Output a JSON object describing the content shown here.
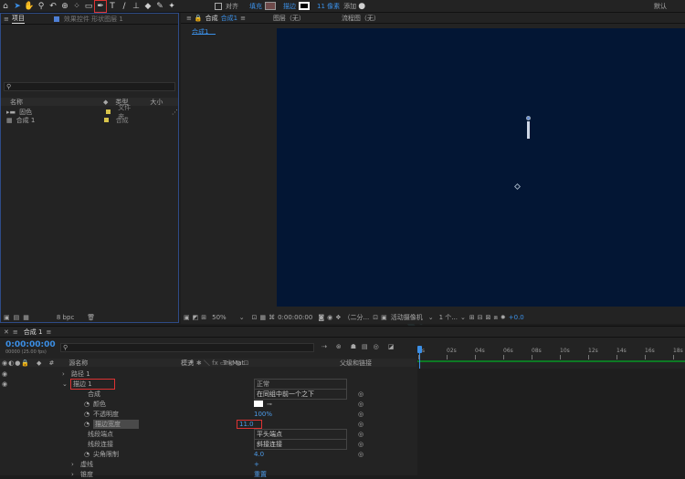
{
  "toolbar": {
    "align_label": "对齐",
    "fill_label": "填充",
    "stroke_label": "描边",
    "stroke_width": "11 像素",
    "add_label": "添加",
    "workspace": "默认",
    "fill_color": "#ffffff",
    "stroke_color": "#6f4b4b"
  },
  "project": {
    "tab": "项目",
    "layer_title": "效果控件 形状图层 1",
    "search_placeholder": "",
    "columns": {
      "name": "名称",
      "type": "类型",
      "size": "大小"
    },
    "items": [
      {
        "name": "固色",
        "type": "文件夹",
        "color": "#d7c34b"
      },
      {
        "name": "合成 1",
        "type": "合成",
        "color": "#d7c34b"
      }
    ],
    "bpc": "8 bpc"
  },
  "viewer": {
    "tabs": {
      "comp": "合成",
      "comp_name": "合成1",
      "layer": "图层（无）",
      "flow": "流程图（无）"
    },
    "subtab": "合成1",
    "bottom": {
      "zoom": "50%",
      "timecode": "0:00:00:00",
      "resolution": "（二分...",
      "camera": "活动摄像机",
      "views": "1 个...",
      "exposure": "+0.0"
    }
  },
  "timeline": {
    "tab": "合成 1",
    "timecode": "0:00:00:00",
    "fps": "00000 (25.00 fps)",
    "cols": {
      "source": "源名称",
      "mode": "模式",
      "trk": "TrkMat",
      "parent": "父级和链接"
    },
    "ruler": [
      "0s",
      "02s",
      "04s",
      "06s",
      "08s",
      "10s",
      "12s",
      "14s",
      "16s",
      "18s"
    ],
    "rows": [
      {
        "label": "路径 1",
        "indent": 78,
        "arrow": ">"
      },
      {
        "label": "描边 1",
        "indent": 78,
        "arrow": "v",
        "mode": "正常",
        "boxed": true
      },
      {
        "label": "合成",
        "indent": 96,
        "value": "在同组中前一个之下"
      },
      {
        "label": "颜色",
        "indent": 102,
        "stopwatch": true
      },
      {
        "label": "不透明度",
        "indent": 102,
        "stopwatch": true,
        "value": "100%"
      },
      {
        "label": "描边宽度",
        "indent": 102,
        "stopwatch": true,
        "value": "11.0",
        "highlight": true
      },
      {
        "label": "线段端点",
        "indent": 96,
        "value": "平头端点"
      },
      {
        "label": "线段连接",
        "indent": 96,
        "value": "斜接连接"
      },
      {
        "label": "尖角限制",
        "indent": 102,
        "stopwatch": true,
        "value": "4.0"
      },
      {
        "label": "虚线",
        "indent": 88,
        "arrow": ">",
        "value": "+"
      },
      {
        "label": "锥度",
        "indent": 88,
        "arrow": ">",
        "value": "重置"
      }
    ]
  }
}
